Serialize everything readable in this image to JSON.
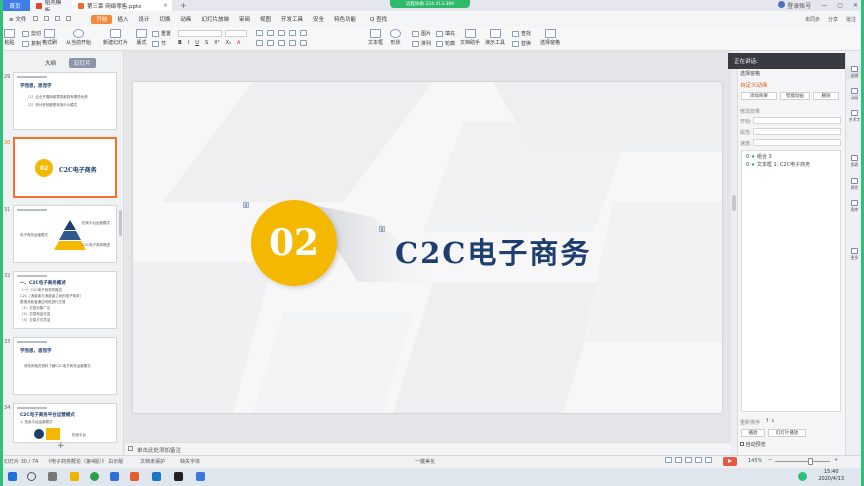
{
  "tabs": {
    "home": "首页",
    "template": "稻壳模板",
    "file": "第三章 网络零售.pptx",
    "plus": "+"
  },
  "remote_banner": "远程协助 224.413.389",
  "window": {
    "login": "登录账号",
    "minimize": "—",
    "maximize": "▢",
    "close": "✕"
  },
  "menu": {
    "file": "≡ 文件",
    "items": [
      "开始",
      "插入",
      "设计",
      "切换",
      "动画",
      "幻灯片放映",
      "审阅",
      "视图",
      "开发工具",
      "安全",
      "特色功能"
    ],
    "active": "开始",
    "search": "Q 查找",
    "right": [
      "未同步",
      "分享",
      "批注"
    ]
  },
  "ribbon": {
    "paste": "粘贴",
    "cut": "剪切",
    "copy": "复制",
    "format_painter": "格式刷",
    "from_current": "从当前开始",
    "new_slide": "新建幻灯片",
    "layout": "版式",
    "section": "节",
    "reset": "重置",
    "text_box": "文本框",
    "shape": "形状",
    "arrange": "排列",
    "picture": "图片",
    "fill": "填充",
    "outline": "轮廓",
    "text_assistant": "文档助手",
    "presentation_tools": "演示工具",
    "find": "查找",
    "replace": "替换",
    "select_pane": "选择窗格",
    "font_buttons": [
      "B",
      "I",
      "U",
      "S",
      "X²",
      "X₂",
      "A"
    ]
  },
  "left_panel": {
    "tabs": [
      "大纲",
      "幻灯片"
    ],
    "active_tab": "幻灯片",
    "slides": [
      {
        "num": "29",
        "title": "学而思，思而学",
        "lines": [
          "（1）企业开展网络零售都具有哪些优势",
          "（2）请分析其都是采用什么模式"
        ]
      },
      {
        "num": "30",
        "badge": "02",
        "title": "C2C电子商务"
      },
      {
        "num": "31",
        "title": "C2C电子商务",
        "lines": [
          "拍卖平台运营模式",
          "电子商务运营模式",
          "C2C电子商务概述"
        ]
      },
      {
        "num": "32",
        "title": "一、C2C电子商务概述",
        "lines": [
          "（一）C2C电子商务的概念",
          "C2C（消费者与消费者之间的电子商务）",
          "是指消费者通过网络进行交易",
          "（1）交易对象广泛",
          "（2）交易商品丰富",
          "（3）交易方式灵活"
        ]
      },
      {
        "num": "33",
        "title": "学而思，思而学",
        "lines": [
          "请查询相关资料了解C2C电子商务运营模式"
        ]
      },
      {
        "num": "34",
        "title": "C2C电子商务平台运营模式",
        "lines": [
          "1. 拍卖平台运营模式",
          "拍卖平台"
        ]
      }
    ],
    "add": "+"
  },
  "slide": {
    "number_badge": "02",
    "title": "C2C电子商务",
    "anim_marker_1": "0",
    "anim_marker_2": "0"
  },
  "notes_placeholder": "单击此处添加备注",
  "right_panel": {
    "header": "正在讲话:",
    "select_pane": "选择窗格",
    "custom_animation": "自定义动画",
    "add_effect": "添加效果",
    "smart_animation": "智能动画",
    "delete": "删除",
    "modify_effect": "修改效果",
    "start_label": "开始:",
    "property_label": "属性:",
    "speed_label": "速度:",
    "list_items": [
      {
        "idx": "0",
        "name": "组合 3"
      },
      {
        "idx": "0",
        "name": "文本框 1: C2C电子商务"
      }
    ],
    "reorder": "重新排序",
    "play": "播放",
    "slideshow": "幻灯片播放",
    "autopreview": "自动预览"
  },
  "icon_strip": [
    "选择",
    "动画",
    "艺术字",
    "图表",
    "属性",
    "图库",
    "更多"
  ],
  "status": {
    "slide_counter": "幻灯片 30 / 74",
    "theme": "《电子商务概论（第4版）》 白示版",
    "protect": "文档未保护",
    "missing_font": "缺失字体",
    "beautify": "一键美化",
    "zoom": "145%",
    "zoom_minus": "−",
    "zoom_plus": "+"
  },
  "taskbar": {
    "time": "15:40",
    "date": "2020/4/13"
  },
  "colors": {
    "accent_orange": "#f4893b",
    "badge_yellow": "#f5b800",
    "title_navy": "#1e3e70",
    "frame_green": "#2fc07a"
  }
}
